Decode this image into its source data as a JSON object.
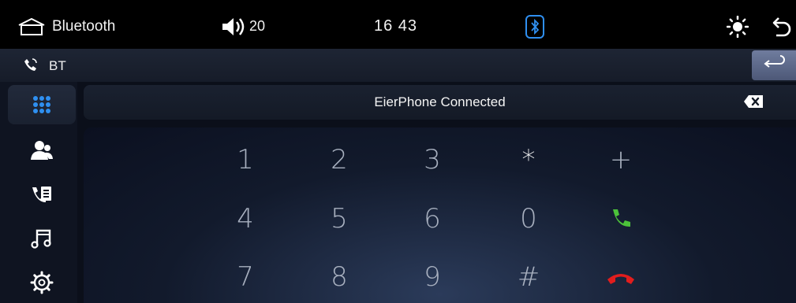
{
  "topbar": {
    "home_icon": "home-icon",
    "title": "Bluetooth",
    "volume_icon": "volume-icon",
    "volume": "20",
    "clock": "16 43",
    "bt_icon": "bluetooth-icon",
    "brightness_icon": "brightness-icon",
    "back_icon": "back-arrow-icon"
  },
  "subbar": {
    "icon": "phone-icon",
    "title": "BT",
    "return_icon": "return-icon"
  },
  "sidebar": [
    {
      "name": "dialpad",
      "icon": "dialpad-icon",
      "active": true
    },
    {
      "name": "contacts",
      "icon": "contacts-icon",
      "active": false
    },
    {
      "name": "call-log",
      "icon": "call-log-icon",
      "active": false
    },
    {
      "name": "music",
      "icon": "music-icon",
      "active": false
    },
    {
      "name": "settings",
      "icon": "settings-icon",
      "active": false
    }
  ],
  "status": {
    "text": "EierPhone Connected",
    "backspace_icon": "backspace-icon"
  },
  "keypad": {
    "row1": [
      "1",
      "2",
      "3",
      "*",
      "+"
    ],
    "row2": [
      "4",
      "5",
      "6",
      "0"
    ],
    "row3": [
      "7",
      "8",
      "9",
      "#"
    ],
    "call_icon": "call-icon",
    "hangup_icon": "hangup-icon"
  },
  "colors": {
    "accent_blue": "#2f8ff0",
    "call_green": "#4cc23a",
    "hangup_red": "#e21d1d"
  }
}
